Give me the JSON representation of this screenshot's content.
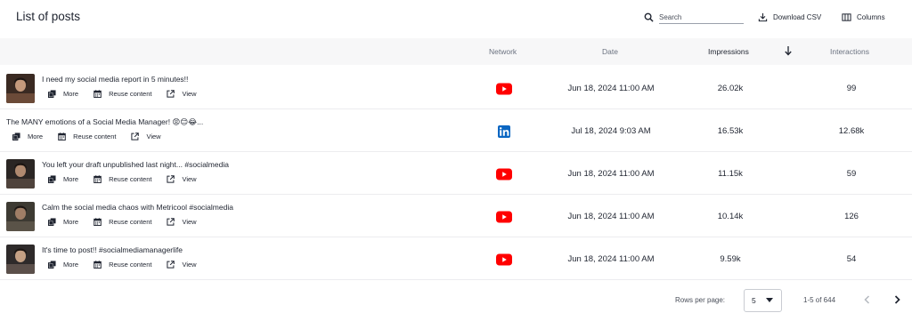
{
  "header": {
    "title": "List of posts",
    "search_placeholder": "Search",
    "download_label": "Download CSV",
    "columns_label": "Columns"
  },
  "table": {
    "columns": {
      "network": "Network",
      "date": "Date",
      "impressions": "Impressions",
      "interactions": "Interactions"
    },
    "sort": {
      "column": "Impressions",
      "direction": "descending"
    },
    "action_labels": {
      "more": "More",
      "reuse": "Reuse content",
      "view": "View"
    },
    "rows": [
      {
        "title": "I need my social media report in 5 minutes!!",
        "network": "youtube-icon",
        "date": "Jun 18, 2024 11:00 AM",
        "impressions": "26.02k",
        "interactions": "99",
        "has_thumb": true
      },
      {
        "title": "The MANY emotions of a Social Media Manager! 😡😊😂...",
        "network": "linkedin-icon",
        "date": "Jul 18, 2024 9:03 AM",
        "impressions": "16.53k",
        "interactions": "12.68k",
        "has_thumb": false
      },
      {
        "title": "You left your draft unpublished last night... #socialmedia",
        "network": "youtube-icon",
        "date": "Jun 18, 2024 11:00 AM",
        "impressions": "11.15k",
        "interactions": "59",
        "has_thumb": true
      },
      {
        "title": "Calm the social media chaos with Metricool #socialmedia",
        "network": "youtube-icon",
        "date": "Jun 18, 2024 11:00 AM",
        "impressions": "10.14k",
        "interactions": "126",
        "has_thumb": true
      },
      {
        "title": "It's time to post!! #socialmediamanagerlife",
        "network": "youtube-icon",
        "date": "Jun 18, 2024 11:00 AM",
        "impressions": "9.59k",
        "interactions": "54",
        "has_thumb": true
      }
    ]
  },
  "footer": {
    "rows_per_page_label": "Rows per page:",
    "rows_per_page_value": "5",
    "range_text": "1-5 of 644"
  },
  "colors": {
    "youtube": "#ff0000",
    "linkedin": "#0a66c2",
    "header_bg": "#f7f7f8",
    "text": "#1f2430",
    "muted": "#6b7280"
  }
}
